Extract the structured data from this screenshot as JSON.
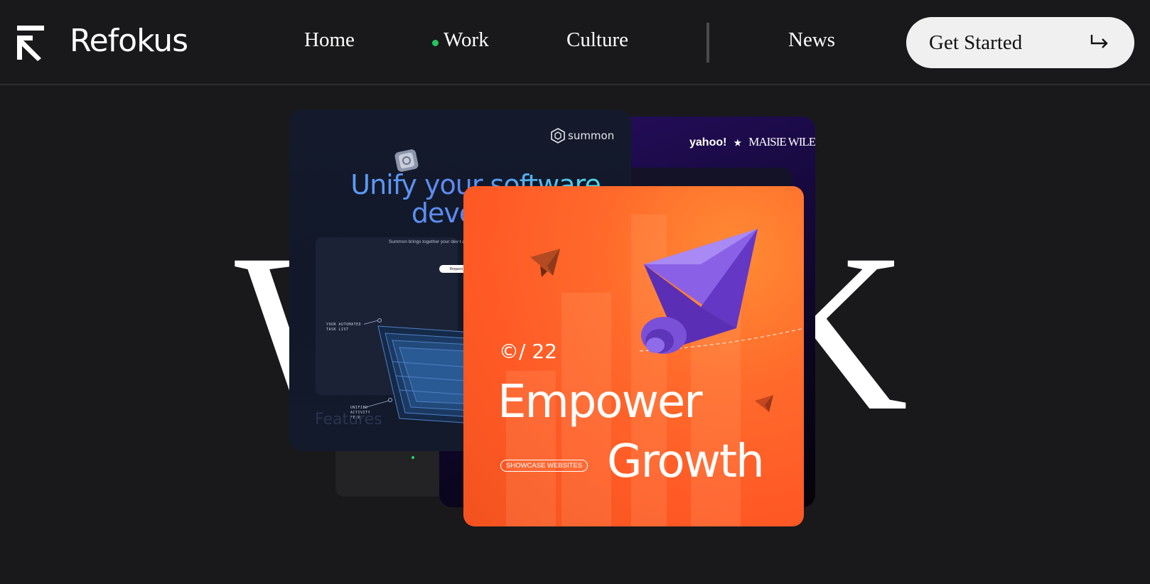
{
  "header": {
    "brand": "Refokus",
    "nav": [
      {
        "label": "Home"
      },
      {
        "label": "Work",
        "active": true
      },
      {
        "label": "Culture"
      },
      {
        "label": "News"
      }
    ],
    "cta_label": "Get Started",
    "active_color": "#23c55e"
  },
  "hero": {
    "big_text": "WORK"
  },
  "cards": {
    "dark": {
      "brand": "summon",
      "headline": "Unify your software\ndevelopm",
      "subtext": "Summon brings together your dev t\napp. Discover the new platform fo",
      "button": "Request A",
      "label1": "YOUR AUTOMATED\nTASK LIST",
      "label2": "UNIFIED\nACTIVITY\nFEED",
      "features": "Features"
    },
    "purple": {
      "partner1": "yahoo!",
      "partner2": "MAISIE WILEN"
    },
    "orange": {
      "year": "©/ 22",
      "word1": "Empower",
      "word2": "Growth",
      "pill": "SHOWCASE WEBSITES"
    }
  },
  "colors": {
    "background": "#19191b",
    "orange": "#ff5a26",
    "purple_shape": "#7b4fd6"
  }
}
